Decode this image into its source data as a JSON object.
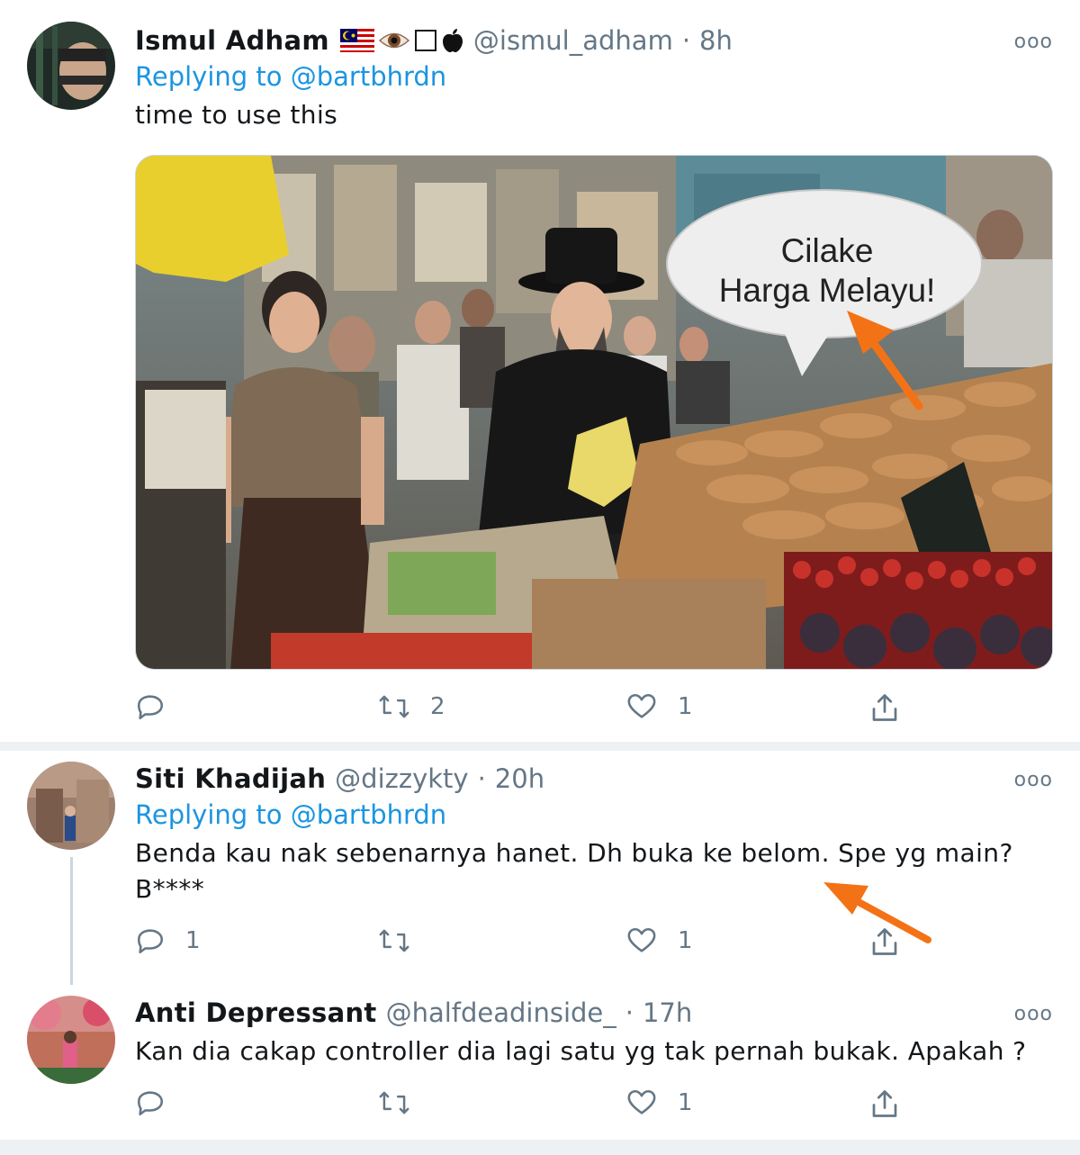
{
  "tweets": [
    {
      "name": "Ismul Adham",
      "handle": "@ismul_adham",
      "time": "8h",
      "replying_prefix": "Replying to",
      "replying_handle": "@bartbhrdn",
      "text": "time to use this",
      "media": {
        "speech_line1": "Cilake",
        "speech_line2": "Harga Melayu!"
      },
      "replies": "",
      "retweets": "2",
      "likes": "1",
      "more": "ooo"
    },
    {
      "name": "Siti Khadijah",
      "handle": "@dizzykty",
      "time": "20h",
      "replying_prefix": "Replying to",
      "replying_handle": "@bartbhrdn",
      "text_line1": "Benda kau nak sebenarnya hanet. Dh buka ke belom. Spe yg main?",
      "text_line2": "B****",
      "replies": "1",
      "retweets": "",
      "likes": "1",
      "more": "ooo"
    },
    {
      "name": "Anti Depressant",
      "handle": "@halfdeadinside_",
      "time": "17h",
      "text": "Kan dia cakap controller dia lagi satu yg tak pernah bukak. Apakah ?",
      "replies": "",
      "retweets": "",
      "likes": "1",
      "more": "ooo"
    }
  ],
  "separator": "·",
  "colors": {
    "link": "#1b95e0",
    "muted": "#657786",
    "annotation_arrow": "#f47216"
  }
}
